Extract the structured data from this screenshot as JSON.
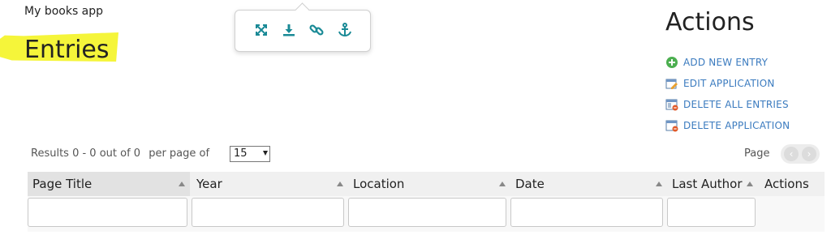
{
  "app": {
    "name": "My books app"
  },
  "page": {
    "title": "Entries"
  },
  "toolbar": {
    "icons": [
      "fullscreen-icon",
      "download-icon",
      "link-icon",
      "anchor-icon"
    ]
  },
  "actions": {
    "title": "Actions",
    "items": [
      {
        "label": "ADD NEW ENTRY",
        "icon": "add-icon"
      },
      {
        "label": "EDIT APPLICATION",
        "icon": "edit-icon"
      },
      {
        "label": "DELETE ALL ENTRIES",
        "icon": "delete-entries-icon"
      },
      {
        "label": "DELETE APPLICATION",
        "icon": "delete-app-icon"
      }
    ]
  },
  "pagination": {
    "results": "Results 0 - 0 out of 0",
    "per_page_label": "per page of",
    "per_page_value": "15",
    "page_label": "Page"
  },
  "table": {
    "columns": [
      "Page Title",
      "Year",
      "Location",
      "Date",
      "Last Author",
      "Actions"
    ]
  },
  "colors": {
    "link": "#3b7bbf",
    "toolbar_icon": "#1a8a96",
    "highlight": "#f5f53a"
  }
}
